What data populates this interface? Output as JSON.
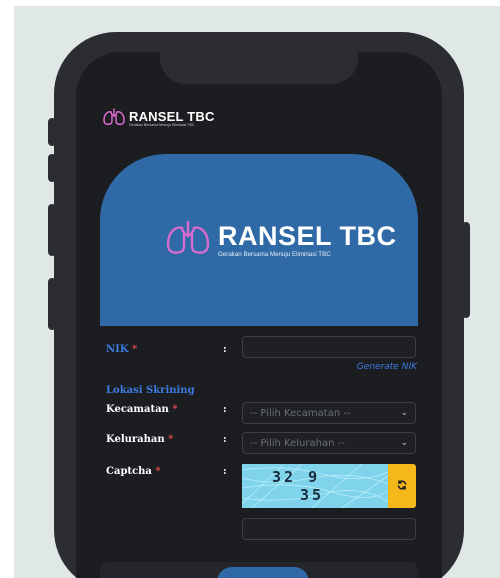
{
  "header": {
    "title": "RANSEL TBC",
    "subtitle": "Gerakan Bersama Menuju Eliminasi TBC"
  },
  "banner": {
    "title": "RANSEL TBC",
    "subtitle": "Gerakan Bersama Menuju Eliminasi TBC"
  },
  "form": {
    "nik": {
      "label": "NIK",
      "required_mark": "*",
      "separator": ":",
      "value": ""
    },
    "generate_nik": "Generate NIK",
    "section_title": "Lokasi Skrining",
    "kecamatan": {
      "label": "Kecamatan",
      "required_mark": "*",
      "separator": ":",
      "placeholder": "-- Pilih Kecamatan --"
    },
    "kelurahan": {
      "label": "Kelurahan",
      "required_mark": "*",
      "separator": ":",
      "placeholder": "-- Pilih Kelurahan --"
    },
    "captcha": {
      "label": "Captcha",
      "required_mark": "*",
      "separator": ":",
      "line1": "32 9",
      "line2": "35",
      "answer": ""
    }
  },
  "icons": {
    "logo": "lungs-icon",
    "dropdown": "chevron-down-icon",
    "refresh": "refresh-icon"
  },
  "colors": {
    "brand_blue": "#2f6aa6",
    "link_blue": "#3d7be0",
    "required_red": "#e24a4a",
    "captcha_bg": "#7fd4ec",
    "refresh_yellow": "#f4b81a",
    "logo_pink": "#d86bd0"
  }
}
